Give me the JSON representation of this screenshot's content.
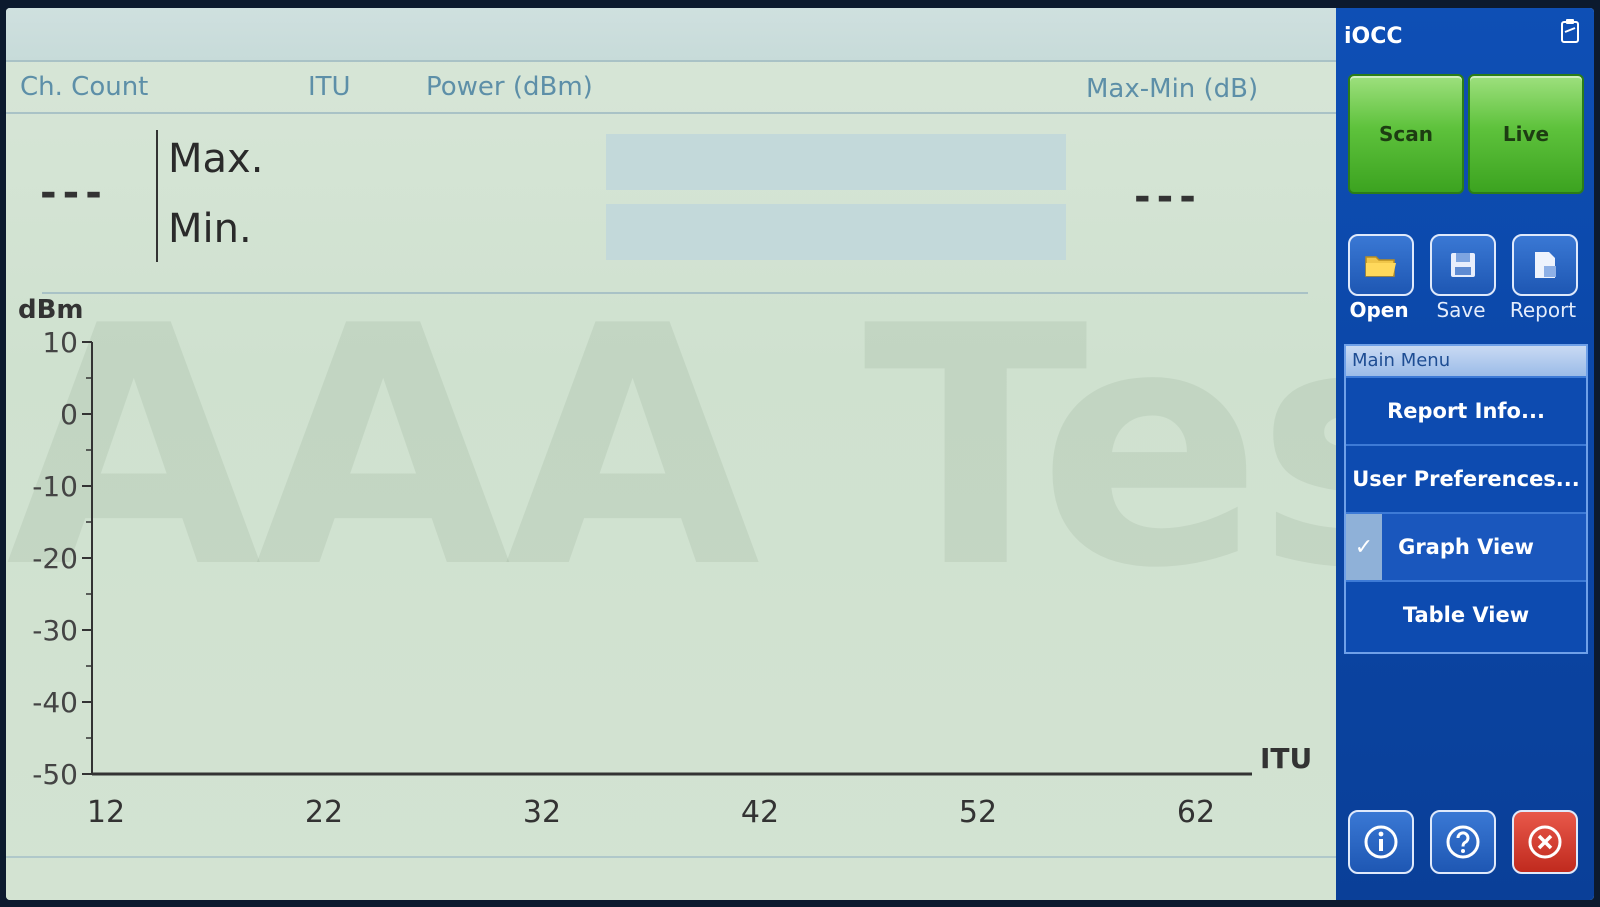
{
  "header": {
    "ch_count": "Ch. Count",
    "itu": "ITU",
    "power": "Power (dBm)",
    "maxmin": "Max-Min (dB)"
  },
  "summary": {
    "count_value": "---",
    "maxmin_value": "---",
    "max_label": "Max.",
    "min_label": "Min."
  },
  "watermark": "AAA Tester",
  "chart_data": {
    "type": "line",
    "ylabel": "dBm",
    "xlabel": "ITU",
    "ylim": [
      -50,
      10
    ],
    "yticks": [
      10,
      0,
      -10,
      -20,
      -30,
      -40,
      -50
    ],
    "xticks": [
      12,
      22,
      32,
      42,
      52,
      62
    ],
    "xlim": [
      12,
      62
    ],
    "series": []
  },
  "side": {
    "title": "iOCC",
    "scan": "Scan",
    "live": "Live",
    "open": "Open",
    "save": "Save",
    "report": "Report",
    "menu_title": "Main Menu",
    "menu_items": [
      "Report Info...",
      "User Preferences...",
      "Graph View",
      "Table View"
    ]
  },
  "colors": {
    "accent": "#0e4fb5",
    "green": "#5ec23c",
    "close": "#d83a2e"
  },
  "icons": [
    "folder-icon",
    "floppy-icon",
    "report-icon",
    "info-icon",
    "help-icon",
    "close-icon",
    "clipboard-icon"
  ]
}
